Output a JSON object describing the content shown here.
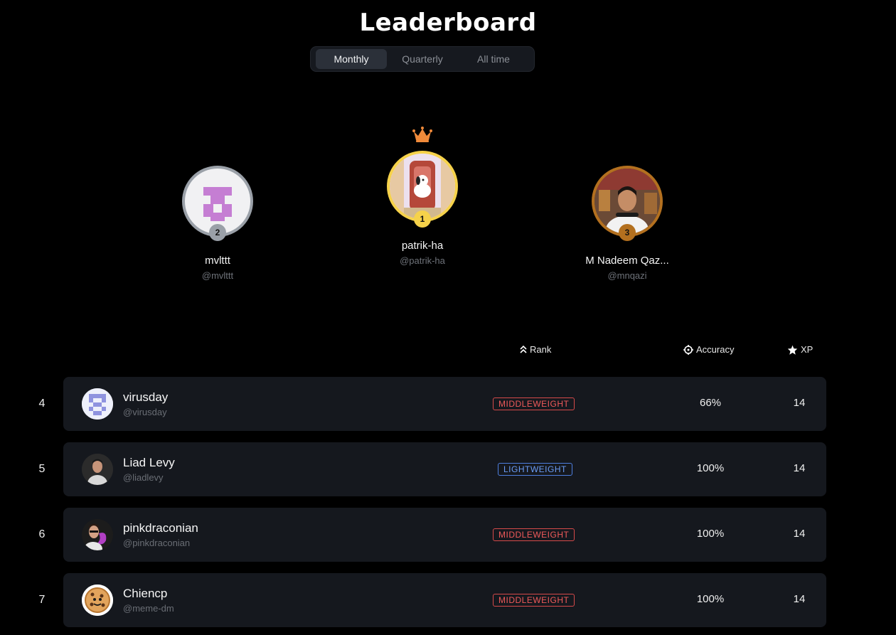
{
  "header": {
    "title": "Leaderboard"
  },
  "tabs": [
    {
      "label": "Monthly",
      "active": true
    },
    {
      "label": "Quarterly",
      "active": false
    },
    {
      "label": "All time",
      "active": false
    }
  ],
  "podium": {
    "crown_icon": "crown-icon",
    "first": {
      "place": "1",
      "name": "patrik-ha",
      "handle": "@patrik-ha",
      "ring_color": "#f6d24a"
    },
    "second": {
      "place": "2",
      "name": "mvlttt",
      "handle": "@mvlttt",
      "ring_color": "#9aa0a8"
    },
    "third": {
      "place": "3",
      "name": "M Nadeem Qaz...",
      "handle": "@mnqazi",
      "ring_color": "#b3701f"
    }
  },
  "table": {
    "columns": {
      "rank": "Rank",
      "accuracy": "Accuracy",
      "xp": "XP"
    },
    "rows": [
      {
        "position": "4",
        "name": "virusday",
        "handle": "@virusday",
        "rank": "MIDDLEWEIGHT",
        "accuracy": "66%",
        "xp": "14"
      },
      {
        "position": "5",
        "name": "Liad Levy",
        "handle": "@liadlevy",
        "rank": "LIGHTWEIGHT",
        "accuracy": "100%",
        "xp": "14"
      },
      {
        "position": "6",
        "name": "pinkdraconian",
        "handle": "@pinkdraconian",
        "rank": "MIDDLEWEIGHT",
        "accuracy": "100%",
        "xp": "14"
      },
      {
        "position": "7",
        "name": "Chiencp",
        "handle": "@meme-dm",
        "rank": "MIDDLEWEIGHT",
        "accuracy": "100%",
        "xp": "14"
      }
    ]
  },
  "colors": {
    "middleweight": "#ef5a5a",
    "lightweight": "#6a9cf5",
    "crown": "#f08a3a"
  }
}
